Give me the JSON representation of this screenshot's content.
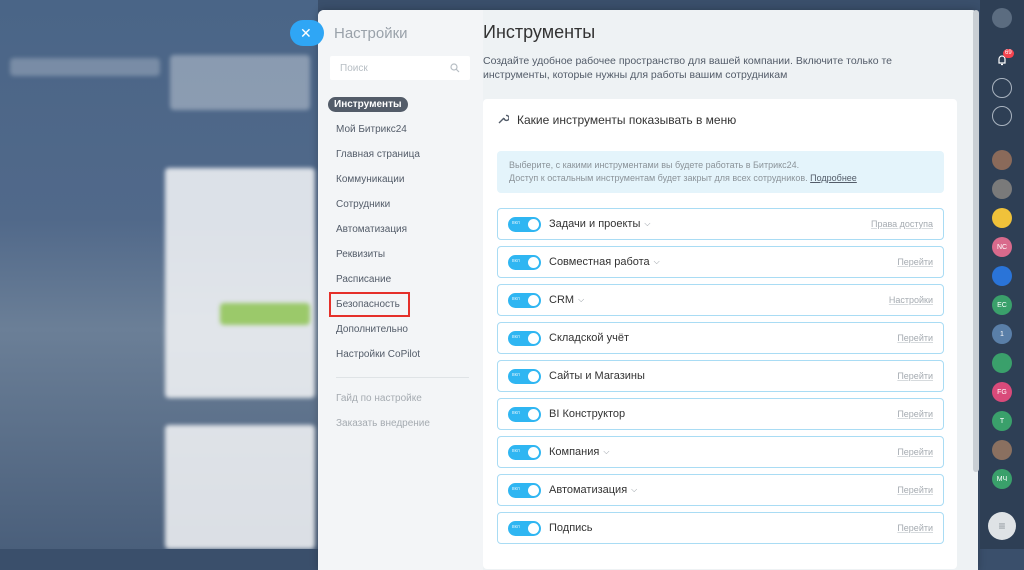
{
  "sidebar": {
    "title": "Настройки",
    "search_placeholder": "Поиск",
    "items": [
      {
        "label": "Инструменты"
      },
      {
        "label": "Мой Битрикс24"
      },
      {
        "label": "Главная страница"
      },
      {
        "label": "Коммуникации"
      },
      {
        "label": "Сотрудники"
      },
      {
        "label": "Автоматизация"
      },
      {
        "label": "Реквизиты"
      },
      {
        "label": "Расписание"
      },
      {
        "label": "Безопасность"
      },
      {
        "label": "Дополнительно"
      },
      {
        "label": "Настройки CoPilot"
      }
    ],
    "footer_items": [
      {
        "label": "Гайд по настройке"
      },
      {
        "label": "Заказать внедрение"
      }
    ]
  },
  "content": {
    "title": "Инструменты",
    "description": "Создайте удобное рабочее пространство для вашей компании. Включите только те инструменты, которые нужны для работы вашим сотрудникам",
    "card_title": "Какие инструменты показывать в меню",
    "info_line1": "Выберите, с какими инструментами вы будете работать в Битрикс24.",
    "info_line2": "Доступ к остальным инструментам будет закрыт для всех сотрудников.",
    "info_link": "Подробнее",
    "toggle_label": "вкл",
    "tools": [
      {
        "name": "Задачи и проекты",
        "link": "Права доступа",
        "dropdown": true
      },
      {
        "name": "Совместная работа",
        "link": "Перейти",
        "dropdown": true
      },
      {
        "name": "CRM",
        "link": "Настройки",
        "dropdown": true
      },
      {
        "name": "Складской учёт",
        "link": "Перейти",
        "dropdown": false
      },
      {
        "name": "Сайты и Магазины",
        "link": "Перейти",
        "dropdown": false
      },
      {
        "name": "BI Конструктор",
        "link": "Перейти",
        "dropdown": false
      },
      {
        "name": "Компания",
        "link": "Перейти",
        "dropdown": true
      },
      {
        "name": "Автоматизация",
        "link": "Перейти",
        "dropdown": true
      },
      {
        "name": "Подпись",
        "link": "Перейти",
        "dropdown": false
      }
    ]
  },
  "rail": {
    "notification_count": "69",
    "avatars": [
      "NC",
      "EC",
      "1",
      "FG",
      "T",
      "МЧ"
    ]
  },
  "colors": {
    "accent": "#2fb6f2",
    "highlight": "#e5302a"
  }
}
